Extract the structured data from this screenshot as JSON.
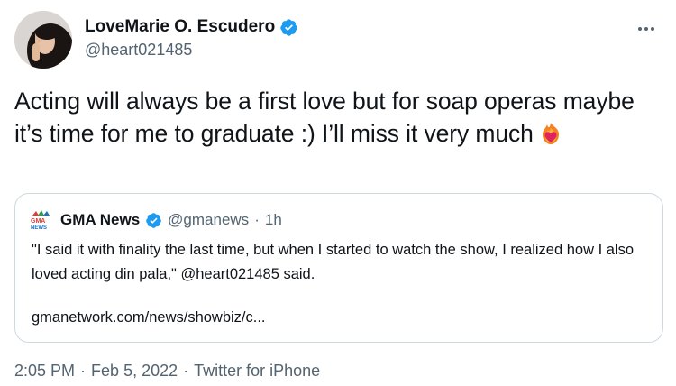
{
  "author": {
    "display_name": "LoveMarie O. Escudero",
    "handle": "@heart021485"
  },
  "tweet": {
    "text": "Acting will always be a first love but for soap operas maybe it’s time for me to graduate :) I’ll miss it very much",
    "emoji": "heart-on-fire"
  },
  "quoted_tweet": {
    "author_name": "GMA News",
    "author_handle": "@gmanews",
    "separator": "·",
    "time_ago": "1h",
    "text": "\"I said it with finality the last time, but when I started to watch the show, I realized how I also loved acting din pala,\" @heart021485 said.",
    "link": "gmanetwork.com/news/showbiz/c..."
  },
  "footer": {
    "time": "2:05 PM",
    "separator": "·",
    "date": "Feb 5, 2022",
    "source": "Twitter for iPhone"
  },
  "colors": {
    "text": "#0f1419",
    "secondary": "#536471",
    "verified": "#1d9bf0",
    "border": "#cfd9de"
  },
  "icons": [
    "verified-badge-icon",
    "more-options-icon",
    "heart-on-fire-emoji",
    "gma-news-logo"
  ]
}
